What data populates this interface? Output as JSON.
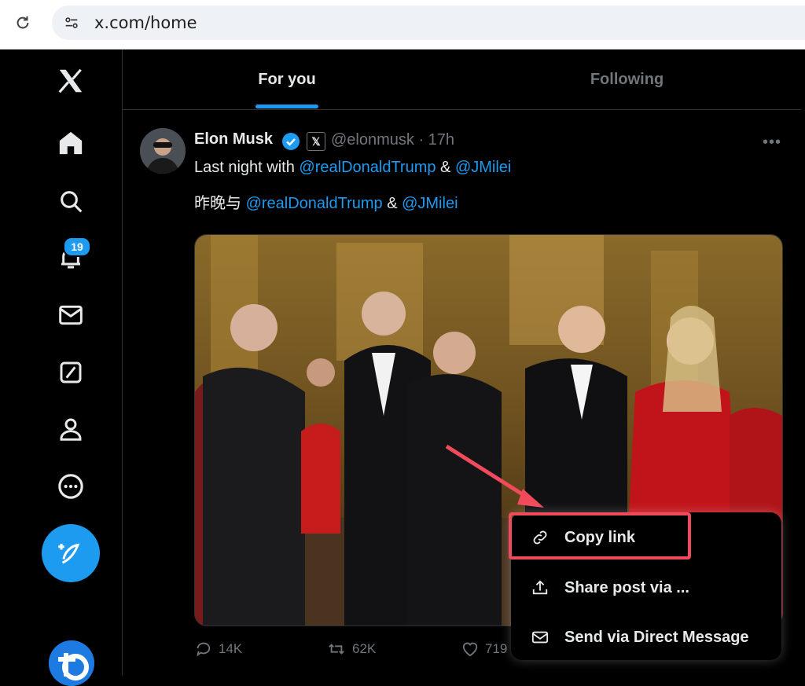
{
  "browser": {
    "url": "x.com/home"
  },
  "tabs": [
    {
      "label": "For you"
    },
    {
      "label": "Following"
    }
  ],
  "sidebar": {
    "notifications_badge": "19"
  },
  "post": {
    "author": "Elon Musk",
    "handle_time": "@elonmusk · 17h",
    "line1": {
      "prefix": "Last night with ",
      "mention1": "@realDonaldTrump",
      "mid": " & ",
      "mention2": "@JMilei"
    },
    "line2": {
      "prefix": "昨晚与 ",
      "mention1": "@realDonaldTrump",
      "mid": " & ",
      "mention2": "@JMilei"
    },
    "stats": {
      "replies": "14K",
      "reposts": "62K",
      "likes": "719"
    }
  },
  "menu": {
    "items": [
      {
        "label": "Copy link",
        "icon": "link-icon"
      },
      {
        "label": "Share post via ...",
        "icon": "share-icon"
      },
      {
        "label": "Send via Direct Message",
        "icon": "envelope-icon"
      }
    ]
  },
  "colors": {
    "accent": "#1d9bf0",
    "highlight": "#f14b5b",
    "background": "#000000"
  }
}
